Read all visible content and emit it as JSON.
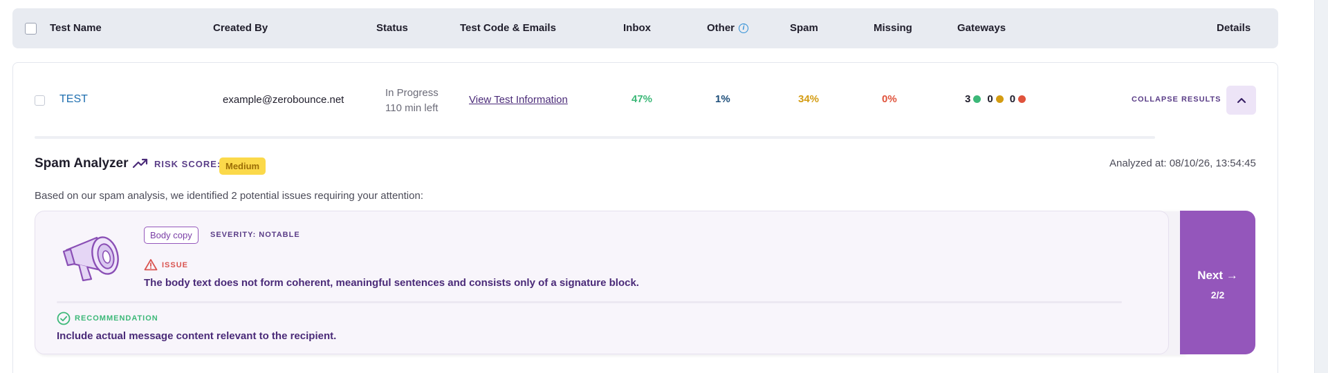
{
  "header": {
    "columns": {
      "test_name": "Test Name",
      "created_by": "Created By",
      "status": "Status",
      "test_code": "Test Code & Emails",
      "inbox": "Inbox",
      "other": "Other",
      "spam": "Spam",
      "missing": "Missing",
      "gateways": "Gateways",
      "details": "Details"
    },
    "info_icon_glyph": "i"
  },
  "row": {
    "test_name": "TEST",
    "created_by": "example@zerobounce.net",
    "status_line1": "In Progress",
    "status_line2": "110 min left",
    "view_link": "View Test Information",
    "inbox": "47%",
    "other": "1%",
    "spam": "34%",
    "missing": "0%",
    "gateways": [
      {
        "count": "3",
        "color": "#3cb878"
      },
      {
        "count": "0",
        "color": "#d49c12"
      },
      {
        "count": "0",
        "color": "#e0533c"
      }
    ],
    "collapse_label": "COLLAPSE RESULTS"
  },
  "analyzer": {
    "title": "Spam Analyzer",
    "risk_label": "RISK SCORE:",
    "risk_value": "Medium",
    "analyzed_at": "Analyzed at: 08/10/26, 13:54:45",
    "summary": "Based on our spam analysis, we identified 2 potential issues requiring your attention:",
    "issue": {
      "tag": "Body copy",
      "severity": "SEVERITY: NOTABLE",
      "issue_label": "ISSUE",
      "issue_text": "The body text does not form coherent, meaningful sentences and consists only of a signature block.",
      "recommendation_label": "RECOMMENDATION",
      "recommendation_text": "Include actual message content relevant to the recipient."
    },
    "next_label": "Next →",
    "next_count": "2/2"
  },
  "colors": {
    "accent_purple": "#9456bb",
    "inbox_green": "#3cb878",
    "spam_yellow": "#d49c12",
    "missing_red": "#e0533c",
    "risk_badge": "#fbd94a"
  }
}
